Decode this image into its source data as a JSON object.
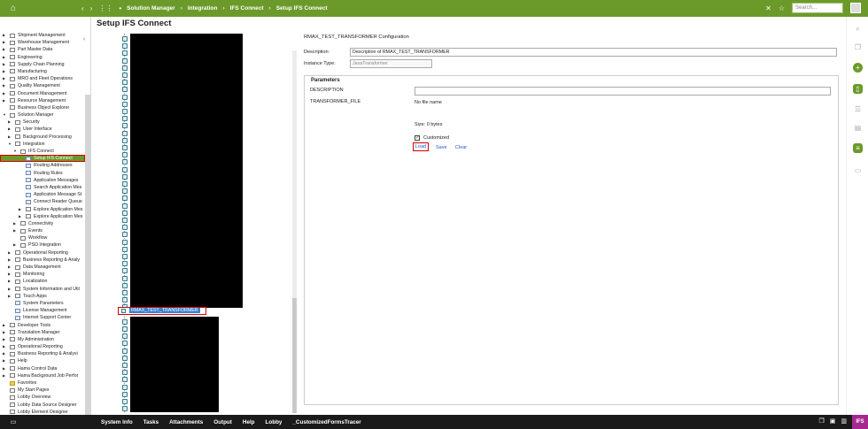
{
  "topbar": {
    "breadcrumbs": [
      "Solution Manager",
      "Integration",
      "IFS Connect",
      "Setup IFS Connect"
    ],
    "search_placeholder": "Search..."
  },
  "sidebar": {
    "items": [
      {
        "label": "Shipment Management",
        "depth": 0,
        "arrow": true
      },
      {
        "label": "Warehouse Management",
        "depth": 0,
        "arrow": true
      },
      {
        "label": "Part Master Data",
        "depth": 0,
        "arrow": true
      },
      {
        "label": "Engineering",
        "depth": 0,
        "arrow": true
      },
      {
        "label": "Supply Chain Planning",
        "depth": 0,
        "arrow": true
      },
      {
        "label": "Manufacturing",
        "depth": 0,
        "arrow": true
      },
      {
        "label": "MRO and Fleet Operations",
        "depth": 0,
        "arrow": true
      },
      {
        "label": "Quality Management",
        "depth": 0,
        "arrow": true
      },
      {
        "label": "Document Management",
        "depth": 0,
        "arrow": true
      },
      {
        "label": "Resource Management",
        "depth": 0,
        "arrow": true
      },
      {
        "label": "Business Object Explorer",
        "depth": 0,
        "arrow": false
      },
      {
        "label": "Solution Manager",
        "depth": 0,
        "arrow": true,
        "open": true
      },
      {
        "label": "Security",
        "depth": 1,
        "arrow": true
      },
      {
        "label": "User Interface",
        "depth": 1,
        "arrow": true
      },
      {
        "label": "Background Processing",
        "depth": 1,
        "arrow": true
      },
      {
        "label": "Integration",
        "depth": 1,
        "arrow": true,
        "open": true
      },
      {
        "label": "IFS Connect",
        "depth": 2,
        "arrow": true,
        "open": true
      },
      {
        "label": "Setup IFS Connect",
        "depth": 3,
        "arrow": false,
        "selected": true,
        "page": true
      },
      {
        "label": "Routing Addresses",
        "depth": 3,
        "arrow": false,
        "page": true
      },
      {
        "label": "Routing Rules",
        "depth": 3,
        "arrow": false,
        "page": true
      },
      {
        "label": "Application Messages",
        "depth": 3,
        "arrow": false,
        "page": true
      },
      {
        "label": "Search Application Mes",
        "depth": 3,
        "arrow": false,
        "page": true
      },
      {
        "label": "Application Message St",
        "depth": 3,
        "arrow": false,
        "page": true
      },
      {
        "label": "Connect Reader Queue",
        "depth": 3,
        "arrow": false,
        "page": true
      },
      {
        "label": "Explore Application Mes",
        "depth": 3,
        "arrow": true
      },
      {
        "label": "Explore Application Mes",
        "depth": 3,
        "arrow": true
      },
      {
        "label": "Connectivity",
        "depth": 2,
        "arrow": true
      },
      {
        "label": "Events",
        "depth": 2,
        "arrow": true
      },
      {
        "label": "Workflow",
        "depth": 2,
        "arrow": false
      },
      {
        "label": "PSO Integration",
        "depth": 2,
        "arrow": true
      },
      {
        "label": "Operational Reporting",
        "depth": 1,
        "arrow": true
      },
      {
        "label": "Business Reporting & Analy",
        "depth": 1,
        "arrow": true
      },
      {
        "label": "Data Management",
        "depth": 1,
        "arrow": true
      },
      {
        "label": "Monitoring",
        "depth": 1,
        "arrow": true
      },
      {
        "label": "Localization",
        "depth": 1,
        "arrow": true
      },
      {
        "label": "System Information and Util",
        "depth": 1,
        "arrow": true
      },
      {
        "label": "Touch Apps",
        "depth": 1,
        "arrow": true
      },
      {
        "label": "System Parameters",
        "depth": 1,
        "arrow": false,
        "page": true
      },
      {
        "label": "License Management",
        "depth": 1,
        "arrow": false,
        "page": true
      },
      {
        "label": "Internet Support Center",
        "depth": 1,
        "arrow": false,
        "page": true
      },
      {
        "label": "Developer Tools",
        "depth": 0,
        "arrow": true
      },
      {
        "label": "Translation Manager",
        "depth": 0,
        "arrow": true
      },
      {
        "label": "My Administration",
        "depth": 0,
        "arrow": true
      },
      {
        "label": "Operational Reporting",
        "depth": 0,
        "arrow": true
      },
      {
        "label": "Business Reporting & Analysi",
        "depth": 0,
        "arrow": true
      },
      {
        "label": "Help",
        "depth": 0,
        "arrow": true
      },
      {
        "label": "Hama Control Data",
        "depth": 0,
        "arrow": true
      },
      {
        "label": "Hama Background Job Perfor",
        "depth": 0,
        "arrow": true
      },
      {
        "label": "Favorites",
        "depth": 0,
        "arrow": false,
        "fav": true
      },
      {
        "label": "My Start Pages",
        "depth": 0,
        "arrow": false
      },
      {
        "label": "Lobby Overview",
        "depth": 0,
        "arrow": false
      },
      {
        "label": "Lobby Data Source Designer",
        "depth": 0,
        "arrow": false
      },
      {
        "label": "Lobby Element Designer",
        "depth": 0,
        "arrow": false
      }
    ]
  },
  "main": {
    "title": "Setup IFS Connect",
    "selected_node": "RMAX_TEST_TRANSFORMER",
    "config_title": "RMAX_TEST_TRANSFORMER Configuration",
    "description_label": "Description:",
    "description_value": "Description of RMAX_TEST_TRANSFORMER",
    "instance_type_label": "Instance Type:",
    "instance_type_value": "JavaTransformer",
    "params_title": "Parameters",
    "param_description_label": "DESCRIPTION",
    "param_file_label": "TRANSFORMER_FILE",
    "file_name": "No file name",
    "file_size": "Size: 0 bytes",
    "customized_label": "Customized",
    "load_label": "Load",
    "save_label": "Save",
    "clear_label": "Clear"
  },
  "bottombar": {
    "items": [
      "System Info",
      "Tasks",
      "Attachments",
      "Output",
      "Help",
      "Lobby",
      "_CustomizedFormsTracer"
    ]
  }
}
